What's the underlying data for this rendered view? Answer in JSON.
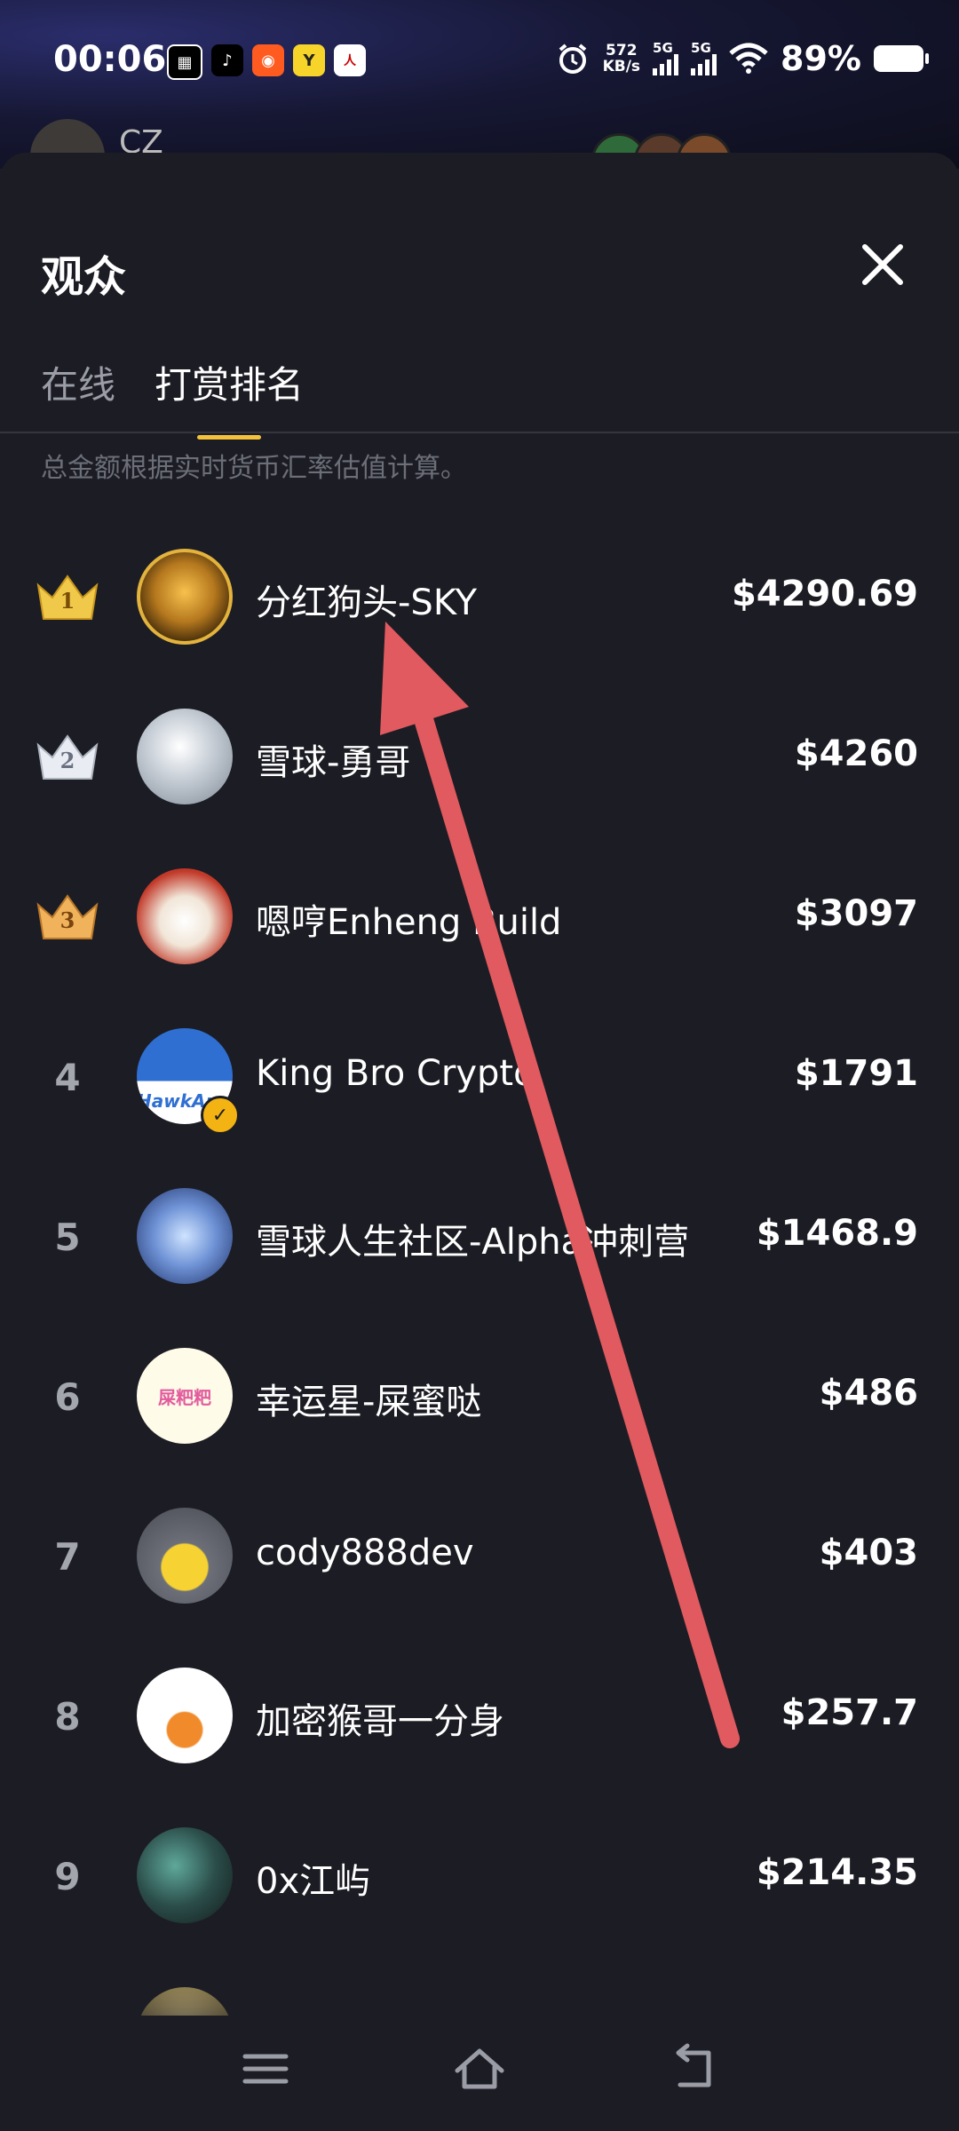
{
  "status_bar": {
    "time": "00:06",
    "net_speed_value": "572",
    "net_speed_unit": "KB/s",
    "sim1": "5G",
    "sim2": "5G",
    "battery": "89%"
  },
  "host": {
    "name": "CZ"
  },
  "sheet": {
    "title": "观众",
    "tabs": [
      {
        "label": "在线",
        "active": false
      },
      {
        "label": "打赏排名",
        "active": true
      }
    ],
    "note": "总金额根据实时货币汇率估值计算。"
  },
  "leaderboard": [
    {
      "rank": "1",
      "name": "分红狗头-SKY",
      "amount": "$4290.69",
      "crown": "gold"
    },
    {
      "rank": "2",
      "name": "雪球-勇哥",
      "amount": "$4260",
      "crown": "silver"
    },
    {
      "rank": "3",
      "name": "嗯哼Enheng Build",
      "amount": "$3097",
      "crown": "bronze"
    },
    {
      "rank": "4",
      "name": "King Bro Crypto",
      "amount": "$1791",
      "avatar_text": "HawkArm"
    },
    {
      "rank": "5",
      "name": "雪球人生社区-Alpha冲刺营",
      "amount": "$1468.9"
    },
    {
      "rank": "6",
      "name": "幸运星-屎蜜哒",
      "amount": "$486",
      "avatar_text": "屎粑粑"
    },
    {
      "rank": "7",
      "name": "cody888dev",
      "amount": "$403"
    },
    {
      "rank": "8",
      "name": "加密猴哥一分身",
      "amount": "$257.7"
    },
    {
      "rank": "9",
      "name": "0x江屿",
      "amount": "$214.35"
    }
  ],
  "colors": {
    "accent": "#f4c23a",
    "arrow": "#e05a5f",
    "background": "#1c1d24"
  }
}
